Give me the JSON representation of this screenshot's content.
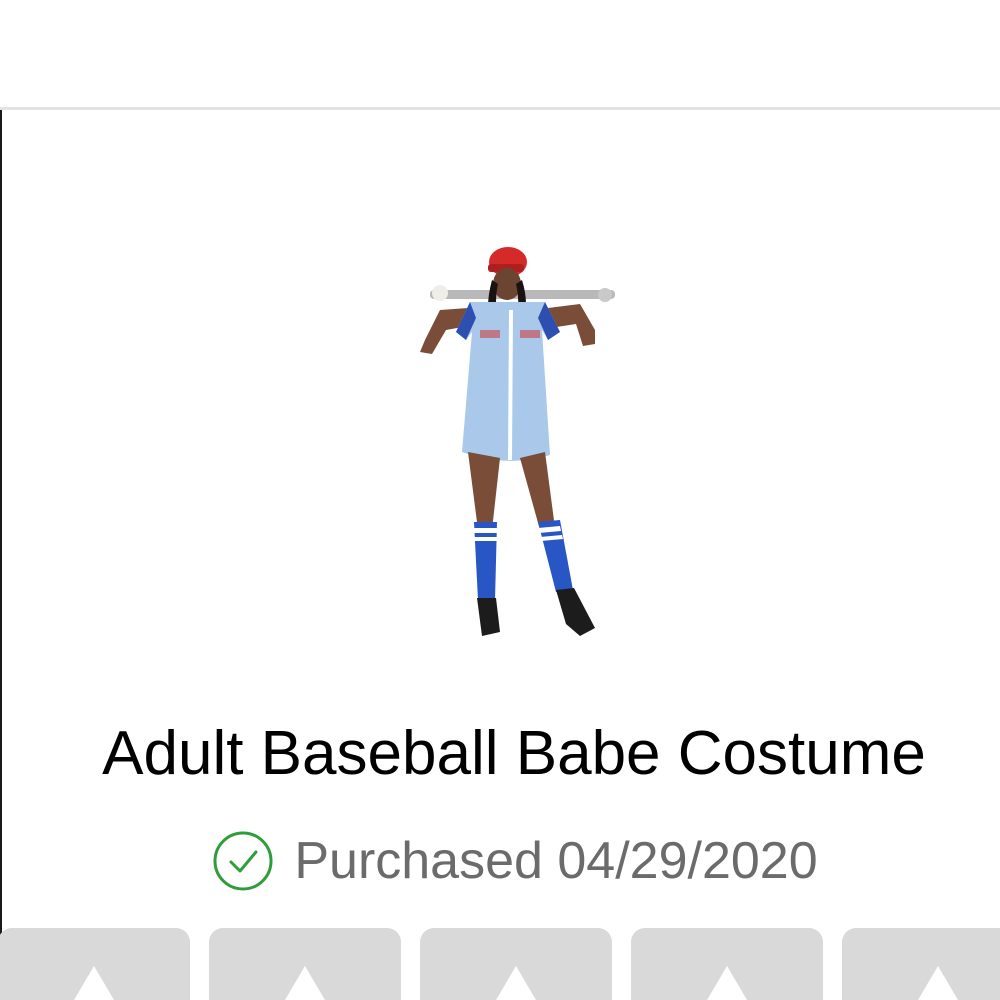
{
  "product": {
    "title": "Adult Baseball Babe Costume",
    "image_icon": "baseball-costume-photo"
  },
  "purchase": {
    "status_icon": "check-circle-icon",
    "status_color": "#2e9e3a",
    "text": "Purchased 04/29/2020"
  },
  "rating_tiles": [
    {
      "icon": "star-icon"
    },
    {
      "icon": "star-icon"
    },
    {
      "icon": "star-icon"
    },
    {
      "icon": "star-icon"
    },
    {
      "icon": "star-icon"
    }
  ],
  "colors": {
    "divider": "#e3e3e3",
    "tile": "#d9d9d9",
    "title": "#000000",
    "subtitle": "#6b6b6b"
  }
}
